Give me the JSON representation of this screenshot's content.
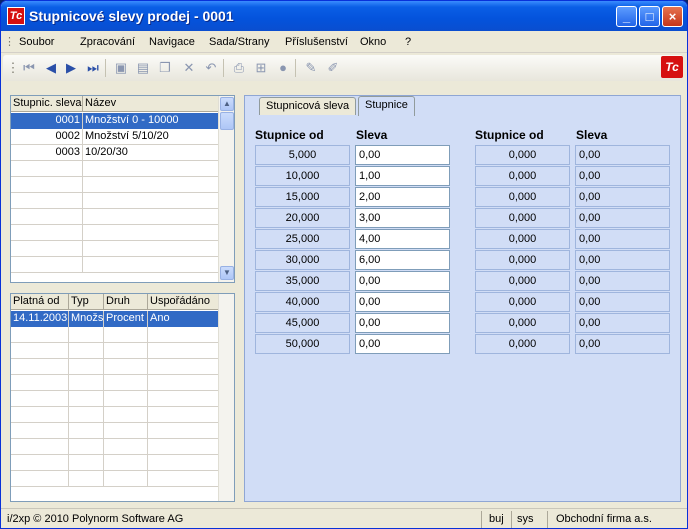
{
  "window": {
    "title": "Stupnicové slevy prodej - 0001",
    "icon_text": "Tc",
    "min": "_",
    "max": "□",
    "close": "×"
  },
  "menu": [
    "Soubor",
    "Zpracování",
    "Navigace",
    "Sada/Strany",
    "Příslušenství",
    "Okno",
    "?"
  ],
  "toolbar": {
    "icons": [
      "first-record-icon",
      "previous-record-icon",
      "next-record-icon",
      "last-record-icon",
      "save-icon",
      "new-document-icon",
      "copy-icon",
      "delete-icon",
      "undo-icon",
      "print-icon",
      "tree-icon",
      "stop-icon",
      "edit-icon",
      "edit-alt-icon"
    ],
    "logo": "Tc"
  },
  "upper_grid": {
    "headers": [
      "Stupnic. sleva",
      "Název"
    ],
    "rows": [
      [
        "0001",
        "Množství 0 - 10000"
      ],
      [
        "0002",
        "Množství 5/10/20"
      ],
      [
        "0003",
        "10/20/30"
      ]
    ]
  },
  "lower_grid": {
    "headers": [
      "Platná od",
      "Typ",
      "Druh",
      "Uspořádáno"
    ],
    "rows": [
      [
        "14.11.2003",
        "Množs",
        "Procent",
        "Ano"
      ]
    ]
  },
  "tabs": [
    "Stupnicová sleva",
    "Stupnice"
  ],
  "table": {
    "col1_header": "Stupnice od",
    "col2_header": "Sleva",
    "col3_header": "Stupnice od",
    "col4_header": "Sleva",
    "left": [
      [
        "5,000",
        "0,00"
      ],
      [
        "10,000",
        "1,00"
      ],
      [
        "15,000",
        "2,00"
      ],
      [
        "20,000",
        "3,00"
      ],
      [
        "25,000",
        "4,00"
      ],
      [
        "30,000",
        "6,00"
      ],
      [
        "35,000",
        "0,00"
      ],
      [
        "40,000",
        "0,00"
      ],
      [
        "45,000",
        "0,00"
      ],
      [
        "50,000",
        "0,00"
      ]
    ],
    "right": [
      [
        "0,000",
        "0,00"
      ],
      [
        "0,000",
        "0,00"
      ],
      [
        "0,000",
        "0,00"
      ],
      [
        "0,000",
        "0,00"
      ],
      [
        "0,000",
        "0,00"
      ],
      [
        "0,000",
        "0,00"
      ],
      [
        "0,000",
        "0,00"
      ],
      [
        "0,000",
        "0,00"
      ],
      [
        "0,000",
        "0,00"
      ],
      [
        "0,000",
        "0,00"
      ]
    ]
  },
  "status": {
    "copyright": "i/2xp © 2010 Polynorm Software AG",
    "user": "buj",
    "system": "sys",
    "company": "Obchodní firma a.s."
  },
  "colors": {
    "selection": "#316ac5",
    "panel": "#d1ddf6",
    "titlebar": "#0453dc"
  }
}
